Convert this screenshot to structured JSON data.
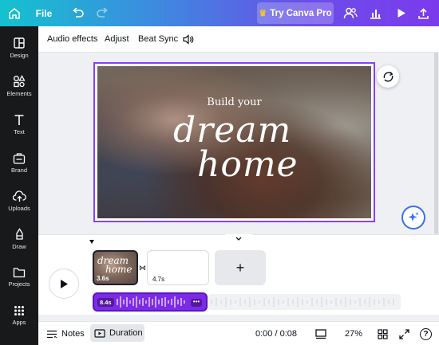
{
  "topbar": {
    "file_label": "File",
    "try_pro_label": "Try Canva Pro"
  },
  "sidebar": {
    "items": [
      {
        "label": "Design",
        "icon": "layout-icon"
      },
      {
        "label": "Elements",
        "icon": "shapes-icon"
      },
      {
        "label": "Text",
        "icon": "text-icon"
      },
      {
        "label": "Brand",
        "icon": "brand-icon"
      },
      {
        "label": "Uploads",
        "icon": "upload-cloud-icon"
      },
      {
        "label": "Draw",
        "icon": "pen-icon"
      },
      {
        "label": "Projects",
        "icon": "folder-icon"
      },
      {
        "label": "Apps",
        "icon": "apps-grid-icon"
      }
    ]
  },
  "toolbar": {
    "audio_effects_label": "Audio effects",
    "adjust_label": "Adjust",
    "beat_sync_label": "Beat Sync"
  },
  "design": {
    "subtitle": "Build your",
    "title_line1": "dream",
    "title_line2": "home"
  },
  "timeline": {
    "clips": [
      {
        "duration": "3.6s",
        "thumb_line1": "dream",
        "thumb_line2": "home"
      },
      {
        "duration": "4.7s"
      }
    ],
    "add_label": "+",
    "audio_duration": "8.4s"
  },
  "bottombar": {
    "notes_label": "Notes",
    "duration_label": "Duration",
    "time_display": "0:00 / 0:08",
    "zoom": "27%",
    "help_label": "?"
  },
  "colors": {
    "accent_purple": "#8b3dff",
    "sidebar_bg": "#18191b",
    "audio_track": "#7d2ae8"
  }
}
